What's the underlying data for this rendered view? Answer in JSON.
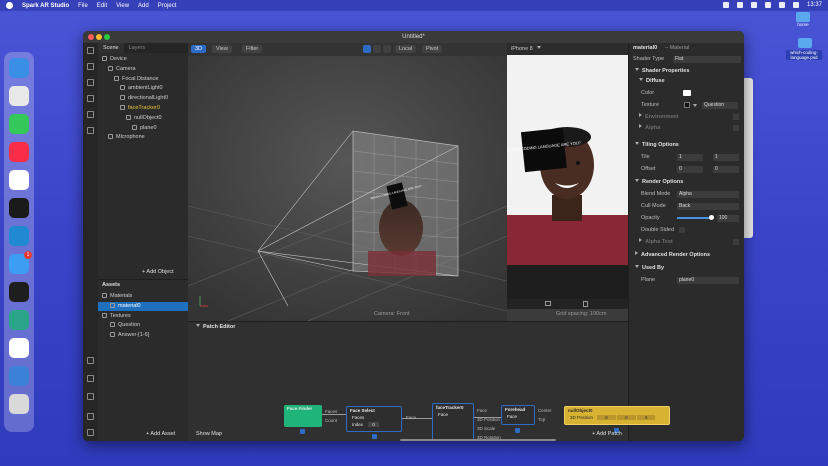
{
  "menubar": {
    "app": "Spark AR Studio",
    "items": [
      "File",
      "Edit",
      "View",
      "Add",
      "Project"
    ],
    "clock": "13:37"
  },
  "desktop": {
    "icons": [
      {
        "label": "home"
      },
      {
        "label": "which-coding-language.psd"
      }
    ]
  },
  "dock": {
    "apps": [
      {
        "name": "finder-icon",
        "color": "#3a8ee6"
      },
      {
        "name": "chrome-icon",
        "color": "#e9e9e9"
      },
      {
        "name": "messages-icon",
        "color": "#34c759"
      },
      {
        "name": "music-icon",
        "color": "#fa2d48"
      },
      {
        "name": "slack-icon",
        "color": "#ffffff"
      },
      {
        "name": "terminal-icon",
        "color": "#1a1a1a"
      },
      {
        "name": "vscode-icon",
        "color": "#1f8ad2"
      },
      {
        "name": "mail-icon",
        "color": "#3d9df2",
        "badge": "1"
      },
      {
        "name": "figma-icon",
        "color": "#1e1e1e"
      },
      {
        "name": "spark-icon",
        "color": "#2aa58a"
      },
      {
        "name": "rocket-icon",
        "color": "#ffffff"
      },
      {
        "name": "bird-icon",
        "color": "#3b82d8"
      },
      {
        "name": "trash-icon",
        "color": "#d9d9d9"
      }
    ]
  },
  "window": {
    "title": "Untitled*"
  },
  "scene": {
    "tabs": [
      "Scene",
      "Layers"
    ],
    "tree": [
      {
        "label": "Device",
        "indent": 0
      },
      {
        "label": "Camera",
        "indent": 1
      },
      {
        "label": "Focal Distance",
        "indent": 2
      },
      {
        "label": "ambientLight0",
        "indent": 3
      },
      {
        "label": "directionalLight0",
        "indent": 3
      },
      {
        "label": "faceTracker0",
        "indent": 3
      },
      {
        "label": "nullObject0",
        "indent": 4
      },
      {
        "label": "plane0",
        "indent": 5
      },
      {
        "label": "Microphone",
        "indent": 1
      }
    ],
    "add_object": "+ Add Object",
    "assets_title": "Assets",
    "assets": [
      {
        "label": "Materials",
        "indent": 0
      },
      {
        "label": "material0",
        "indent": 1
      },
      {
        "label": "Textures",
        "indent": 0
      },
      {
        "label": "Question",
        "indent": 1
      },
      {
        "label": "Answer-[1-6]",
        "indent": 1
      }
    ],
    "add_asset": "+ Add Asset"
  },
  "viewport": {
    "mode": "3D",
    "view": "View",
    "filter": "Filter",
    "local": "Local",
    "pivot": "Pivot",
    "camera_caption": "Camera: Front",
    "grid_caption": "Grid spacing: 100cm",
    "sign_text": "WHICH CODING LANGUAGE ARE YOU?"
  },
  "preview": {
    "device": "iPhone 8",
    "sign_text": "WHICH CODING LANGUAGE ARE YOU?"
  },
  "inspector": {
    "title": "material0",
    "subtitle": "– Material",
    "shader_type_label": "Shader Type",
    "shader_type": "Flat",
    "shader_props": "Shader Properties",
    "diffuse": "Diffuse",
    "color_label": "Color",
    "texture_label": "Texture",
    "texture_value": "Question",
    "environment": "Environment",
    "alpha": "Alpha",
    "tiling": "Tiling Options",
    "tile_label": "Tile",
    "tile_x": "1",
    "tile_y": "1",
    "offset_label": "Offset",
    "offset_x": "0",
    "offset_y": "0",
    "render": "Render Options",
    "blend_label": "Blend Mode",
    "blend_value": "Alpha",
    "cull_label": "Cull Mode",
    "cull_value": "Back",
    "opacity_label": "Opacity",
    "opacity_value": "100",
    "opacity_level": 1.0,
    "double_sided": "Double Sided",
    "alpha_test": "Alpha Test",
    "advanced": "Advanced Render Options",
    "used_by": "Used By",
    "plane_label": "Plane",
    "plane_value": "plane0"
  },
  "patch": {
    "title": "Patch Editor",
    "show_map": "Show Map",
    "add_patch": "+ Add Patch",
    "face_finder": {
      "title": "Face Finder",
      "out1": "Faces",
      "out2": "Count"
    },
    "face_select": {
      "title": "Face Select",
      "in1": "Faces",
      "in2": "Index",
      "index_value": "0",
      "out": "Face"
    },
    "face_tracker": {
      "title": "faceTracker0",
      "in": "Face",
      "out1": "Face",
      "out2": "3D Position",
      "out3": "3D Scale",
      "out4": "3D Rotation"
    },
    "forehead": {
      "title": "Forehead",
      "in": "Face",
      "out1": "Center",
      "out2": "Top"
    },
    "null_object": {
      "title": "nullObject0",
      "in": "3D Position",
      "v1": "0",
      "v2": "0",
      "v3": "0"
    }
  }
}
